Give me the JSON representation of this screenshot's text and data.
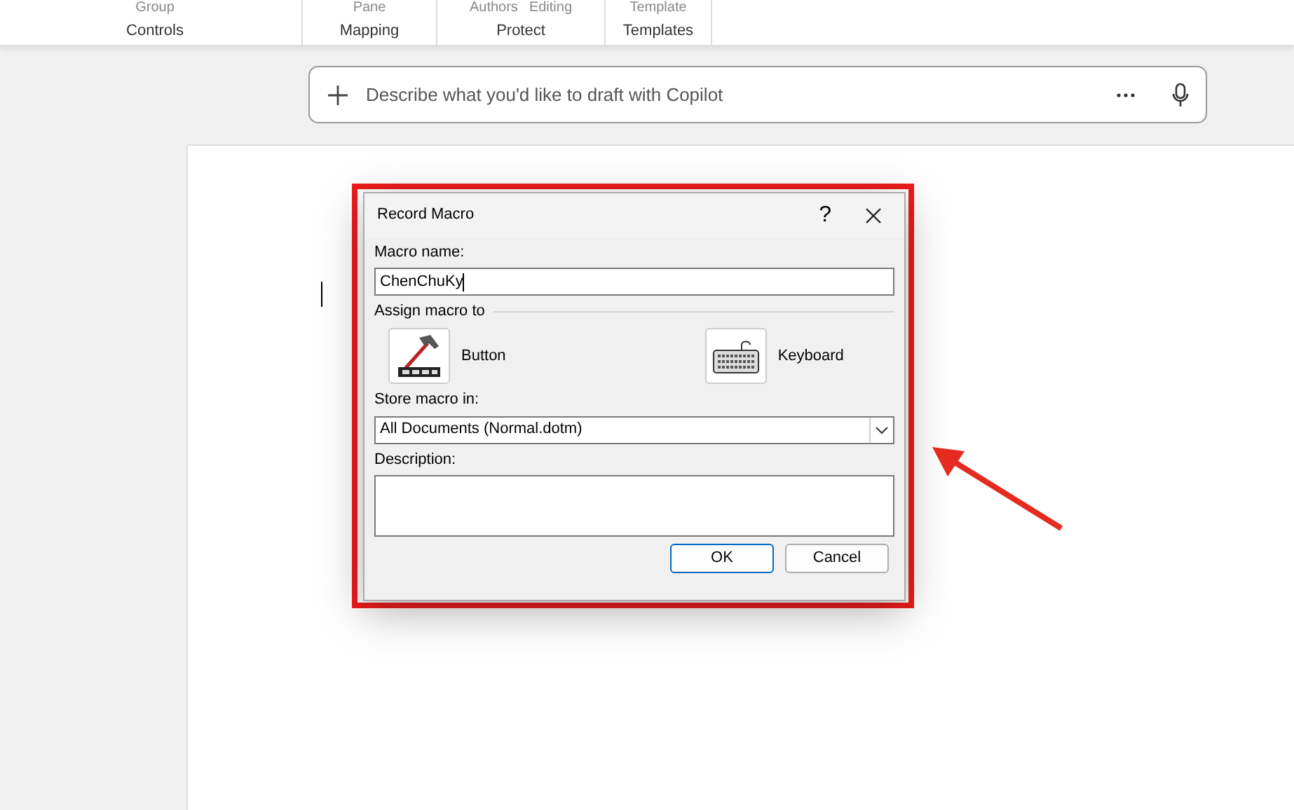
{
  "ribbon": {
    "items": [
      "Group",
      "Pane",
      "Authors",
      "Editing",
      "Template"
    ],
    "groups": [
      "Controls",
      "Mapping",
      "Protect",
      "Templates"
    ]
  },
  "copilot_bar": {
    "placeholder": "Describe what you'd like to draft with Copilot"
  },
  "dialog": {
    "title": "Record Macro",
    "help": "?",
    "macro_name": {
      "label": "Macro name:",
      "value": "ChenChuKy"
    },
    "assign_label": "Assign macro to",
    "assign_buttons": [
      {
        "kind": "button",
        "label": "Button"
      },
      {
        "kind": "keyboard",
        "label": "Keyboard"
      }
    ],
    "store": {
      "label": "Store macro in:",
      "value": "All Documents (Normal.dotm)"
    },
    "description": {
      "label": "Description:"
    },
    "buttons": [
      {
        "label": "OK",
        "default": true
      },
      {
        "label": "Cancel",
        "default": false
      }
    ]
  }
}
